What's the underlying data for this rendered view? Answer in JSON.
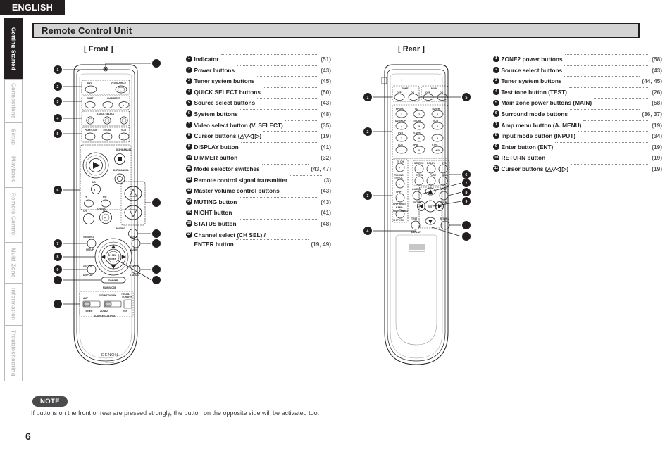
{
  "language_tab": "ENGLISH",
  "page_number": "6",
  "sidebar": {
    "items": [
      {
        "label": "Getting Started",
        "active": true
      },
      {
        "label": "Connections",
        "active": false
      },
      {
        "label": "Setup",
        "active": false
      },
      {
        "label": "Playback",
        "active": false
      },
      {
        "label": "Remote Control",
        "active": false
      },
      {
        "label": "Multi-Zone",
        "active": false
      },
      {
        "label": "Information",
        "active": false
      },
      {
        "label": "Troubleshooting",
        "active": false
      }
    ]
  },
  "section": {
    "title": "Remote Control Unit"
  },
  "views": {
    "front_caption": "[ Front ]",
    "rear_caption": "[ Rear ]"
  },
  "legend_front": [
    {
      "num": "1",
      "label": "Indicator",
      "page": "(51)"
    },
    {
      "num": "2",
      "label": "Power buttons",
      "page": "(43)"
    },
    {
      "num": "3",
      "label": "Tuner system buttons",
      "page": "(45)"
    },
    {
      "num": "4",
      "label": "QUICK SELECT buttons",
      "page": "(50)"
    },
    {
      "num": "5",
      "label": "Source select buttons",
      "page": "(43)"
    },
    {
      "num": "6",
      "label": "System buttons",
      "page": "(48)"
    },
    {
      "num": "7",
      "label": "Video select button (V. SELECT)",
      "page": "(35)"
    },
    {
      "num": "8",
      "label": "Cursor buttons (△▽◁ ▷)",
      "page": "(19)"
    },
    {
      "num": "9",
      "label": "DISPLAY button",
      "page": "(41)"
    },
    {
      "num": "10",
      "label": "DIMMER button",
      "page": "(32)"
    },
    {
      "num": "11",
      "label": "Mode selector switches",
      "page": "(43, 47)"
    },
    {
      "num": "12",
      "label": "Remote control signal transmitter",
      "page": "(3)"
    },
    {
      "num": "13",
      "label": "Master volume control buttons",
      "page": "(43)"
    },
    {
      "num": "14",
      "label": "MUTING button",
      "page": "(43)"
    },
    {
      "num": "15",
      "label": "NIGHT button",
      "page": "(41)"
    },
    {
      "num": "16",
      "label": "STATUS button",
      "page": "(48)"
    },
    {
      "num": "17",
      "label": "Channel select (CH SEL) /",
      "label2": "ENTER button",
      "page": "(19, 49)"
    }
  ],
  "legend_rear": [
    {
      "num": "1",
      "label": "ZONE2 power buttons",
      "page": "(58)"
    },
    {
      "num": "2",
      "label": "Source select buttons",
      "page": "(43)"
    },
    {
      "num": "3",
      "label": "Tuner system buttons",
      "page": "(44, 45)"
    },
    {
      "num": "4",
      "label": "Test tone button (TEST)",
      "page": "(26)"
    },
    {
      "num": "5",
      "label": "Main zone power buttons (MAIN)",
      "page": "(58)"
    },
    {
      "num": "6",
      "label": "Surround mode buttons",
      "page": "(36, 37)"
    },
    {
      "num": "7",
      "label": "Amp menu button (A. MENU)",
      "page": "(19)"
    },
    {
      "num": "8",
      "label": "Input mode button (INPUT)",
      "page": "(34)"
    },
    {
      "num": "9",
      "label": "Enter button (ENT)",
      "page": "(19)"
    },
    {
      "num": "10",
      "label": "RETURN button",
      "page": "(19)"
    },
    {
      "num": "11",
      "label": "Cursor buttons (△▽◁ ▷)",
      "page": "(19)"
    }
  ],
  "note": {
    "badge": "NOTE",
    "text": "If buttons on the front or rear are pressed strongly, the button on the opposite side will be activated too."
  },
  "remote_front": {
    "brand": "DENON",
    "model": "RC-1061",
    "labels": {
      "dvd": "DVD",
      "dvd_source": "DVD SOURCE",
      "off": "OFF",
      "standby": "STANDBY",
      "on": "ON",
      "quick_select": "QUICK SELECT",
      "q1": "1",
      "q2": "2",
      "q3": "3",
      "play_stop": "PLAY/STOP",
      "tv_cbl": "TV/CBL",
      "vcr": "VCR",
      "skip_manual": "SKIP/MANUAL",
      "ab": "A/B",
      "ch_vol": "CH/VOL",
      "v_select": "V.SELECT",
      "setup": "SETUP",
      "night": "NIGHT",
      "audio": "AUDIO",
      "muting": "MUTING",
      "ch_sel": "CH SEL",
      "enter": "ENTER",
      "display": "DISPLAY",
      "dimmer": "DIMMER",
      "return": "RETURN",
      "status": "STATUS",
      "main_mode": "MAIN/MODE",
      "source_control": "SOURCE CONTROL",
      "amp": "AMP",
      "dvd_network": "DVD/NETWORK",
      "zone2": "ZONE2",
      "tuner": "TUNER"
    }
  },
  "remote_rear": {
    "labels": {
      "zone2": "ZONE2",
      "main": "MAIN",
      "off": "OFF",
      "on": "ON",
      "phono": "PHONO",
      "cd": "CD",
      "tuner": "TUNER",
      "dvd_hdp": "DVD/HDP",
      "tv_cbl": "TV/CBL",
      "vcr": "VCR",
      "dvr": "DVR",
      "v_aux": "V.AUX",
      "aux": "AUX",
      "ipod": "iPod",
      "ctrl": "CTRL",
      "n1": "1",
      "n2": "2",
      "n3": "3",
      "n4": "4",
      "n5": "5",
      "n6": "6",
      "n7": "7",
      "n8": "8",
      "n9": "9",
      "n0": "0",
      "n10": "+10",
      "stereo": "STEREO",
      "dolby": "DOLBY",
      "dts": "DTS",
      "ext_in": "EXT.IN",
      "pure": "PURE",
      "simu": "SIMU",
      "tuning": "TUNING",
      "tv_vol": "TV/VOL",
      "shift": "SHIFT",
      "ch_preset": "CH/PRESET",
      "band": "BAND",
      "mode_memo": "MODE/MEMO",
      "a_menu": "A.MENU",
      "setup": "SETUP",
      "input": "INPUT",
      "aux_b": "AUX B",
      "ent": "ENT",
      "return": "RETURN",
      "test": "TEST",
      "display": "DISPLAY"
    }
  },
  "colors": {
    "ink": "#231f20",
    "title_bar_fill": "#d4d4d4",
    "tab_inactive_text": "#bdbdbd",
    "note_badge": "#4a4a4c",
    "dots": "#8b8b8b",
    "page_ref": "#58585a"
  }
}
